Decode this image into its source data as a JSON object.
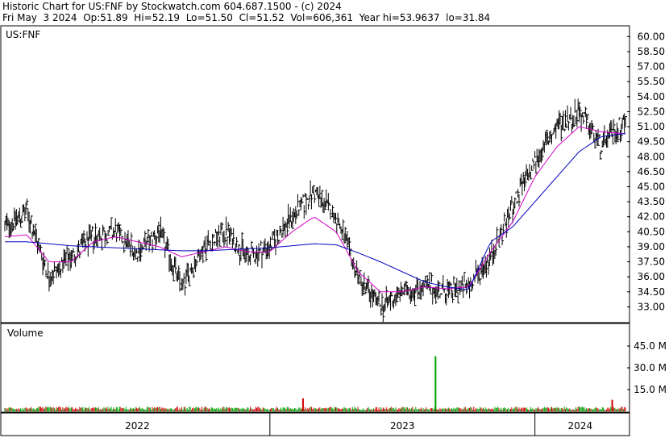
{
  "header": {
    "title": "Historic Chart for US:FNF by Stockwatch.com 604.687.1500 - (c) 2024",
    "date": "Fri May  3 2024",
    "open": "Op:51.89",
    "high": "Hi=52.19",
    "low": "Lo=51.50",
    "close": "Cl=51.52",
    "volume": "Vol=606,361",
    "year_high": "Year hi=53.9637",
    "year_low": "lo=31.84"
  },
  "price_panel": {
    "symbol": "US:FNF"
  },
  "volume_panel": {
    "title": "Volume"
  },
  "colors": {
    "price_bars": "#000000",
    "ma_short": "#d400c8",
    "ma_long": "#0000c0",
    "volume_up": "#00a000",
    "volume_down": "#d00000",
    "grid": "#9a9a9a",
    "border": "#000000"
  },
  "chart_data": [
    {
      "type": "line",
      "title": "US:FNF",
      "x": [
        "2022-01",
        "2022-02",
        "2022-03",
        "2022-04",
        "2022-05",
        "2022-06",
        "2022-07",
        "2022-08",
        "2022-09",
        "2022-10",
        "2022-11",
        "2022-12",
        "2023-01",
        "2023-02",
        "2023-03",
        "2023-04",
        "2023-05",
        "2023-06",
        "2023-07",
        "2023-08",
        "2023-09",
        "2023-10",
        "2023-11",
        "2023-12",
        "2024-01",
        "2024-02",
        "2024-03",
        "2024-04",
        "2024-05"
      ],
      "series": [
        {
          "name": "",
          "kind": "price_bars",
          "values": [
            41.0,
            42.5,
            36.0,
            38.0,
            40.0,
            40.5,
            38.5,
            40.5,
            35.0,
            39.0,
            40.5,
            38.0,
            39.0,
            42.0,
            44.5,
            42.0,
            36.0,
            33.0,
            34.5,
            35.0,
            34.5,
            35.0,
            34.0,
            38.0,
            41.0,
            43.5,
            40.0,
            38.0,
            42.5
          ]
        },
        {
          "name": "",
          "kind": "ma_short",
          "values": [
            40.0,
            40.2,
            37.5,
            37.5,
            39.5,
            40.0,
            39.5,
            39.0,
            38.0,
            38.5,
            39.0,
            38.5,
            38.5,
            40.5,
            42.0,
            40.5,
            36.5,
            34.5,
            34.5,
            35.0,
            34.8,
            35.0,
            34.8,
            37.5,
            40.0,
            42.5,
            40.5,
            39.0,
            41.5
          ]
        },
        {
          "name": "",
          "kind": "ma_long",
          "values": [
            39.5,
            39.5,
            39.3,
            39.1,
            39.0,
            38.9,
            38.8,
            38.7,
            38.6,
            38.6,
            38.7,
            38.8,
            38.9,
            39.1,
            39.3,
            39.2,
            38.4,
            37.5,
            36.5,
            35.5,
            35.0,
            34.7,
            34.8,
            35.5,
            36.8,
            38.0,
            38.6,
            39.0,
            40.2
          ]
        }
      ],
      "x_late": [
        "2023-11",
        "2023-12",
        "2024-01",
        "2024-02",
        "2024-03",
        "2024-04",
        "2024-05"
      ],
      "series_late": [
        {
          "name": "",
          "kind": "price_bars",
          "values": [
            38.0,
            43.0,
            47.5,
            51.0,
            52.5,
            49.0,
            51.5
          ]
        },
        {
          "name": "",
          "kind": "ma_short",
          "values": [
            38.5,
            41.5,
            46.0,
            49.0,
            51.0,
            50.5,
            50.3
          ]
        },
        {
          "name": "",
          "kind": "ma_long",
          "values": [
            39.5,
            41.0,
            43.5,
            46.0,
            48.5,
            50.0,
            50.3
          ]
        }
      ],
      "xlabel": "",
      "ylabel": "",
      "x_ticks": [
        "2022",
        "2023",
        "2024"
      ],
      "y_ticks": [
        60.0,
        58.5,
        57.0,
        55.5,
        54.0,
        52.5,
        51.0,
        49.5,
        48.0,
        46.5,
        45.0,
        43.5,
        42.0,
        40.5,
        39.0,
        37.5,
        36.0,
        34.5,
        33.0
      ],
      "ylim": [
        31.5,
        61.0
      ],
      "y_axis": "right",
      "grid": false
    },
    {
      "type": "bar",
      "title": "Volume",
      "y_ticks": [
        "45.0 M",
        "30.0 M",
        "15.0 M"
      ],
      "y_tick_values": [
        45,
        30,
        15
      ],
      "ylim": [
        0,
        60
      ],
      "y_axis": "right",
      "notable_spikes": [
        {
          "x": "2023-02",
          "value": 9
        },
        {
          "x": "2023-08",
          "value": 38
        },
        {
          "x": "2024-04",
          "value": 8
        }
      ],
      "typical_value": 2.5
    }
  ]
}
